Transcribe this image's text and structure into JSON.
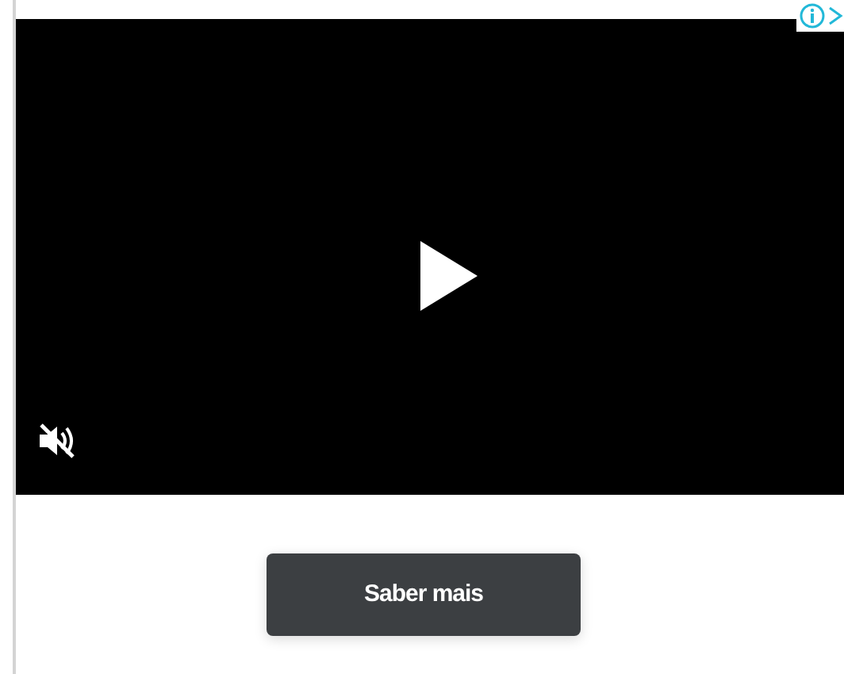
{
  "video": {
    "muted": true
  },
  "cta_button": {
    "label": "Saber mais"
  }
}
